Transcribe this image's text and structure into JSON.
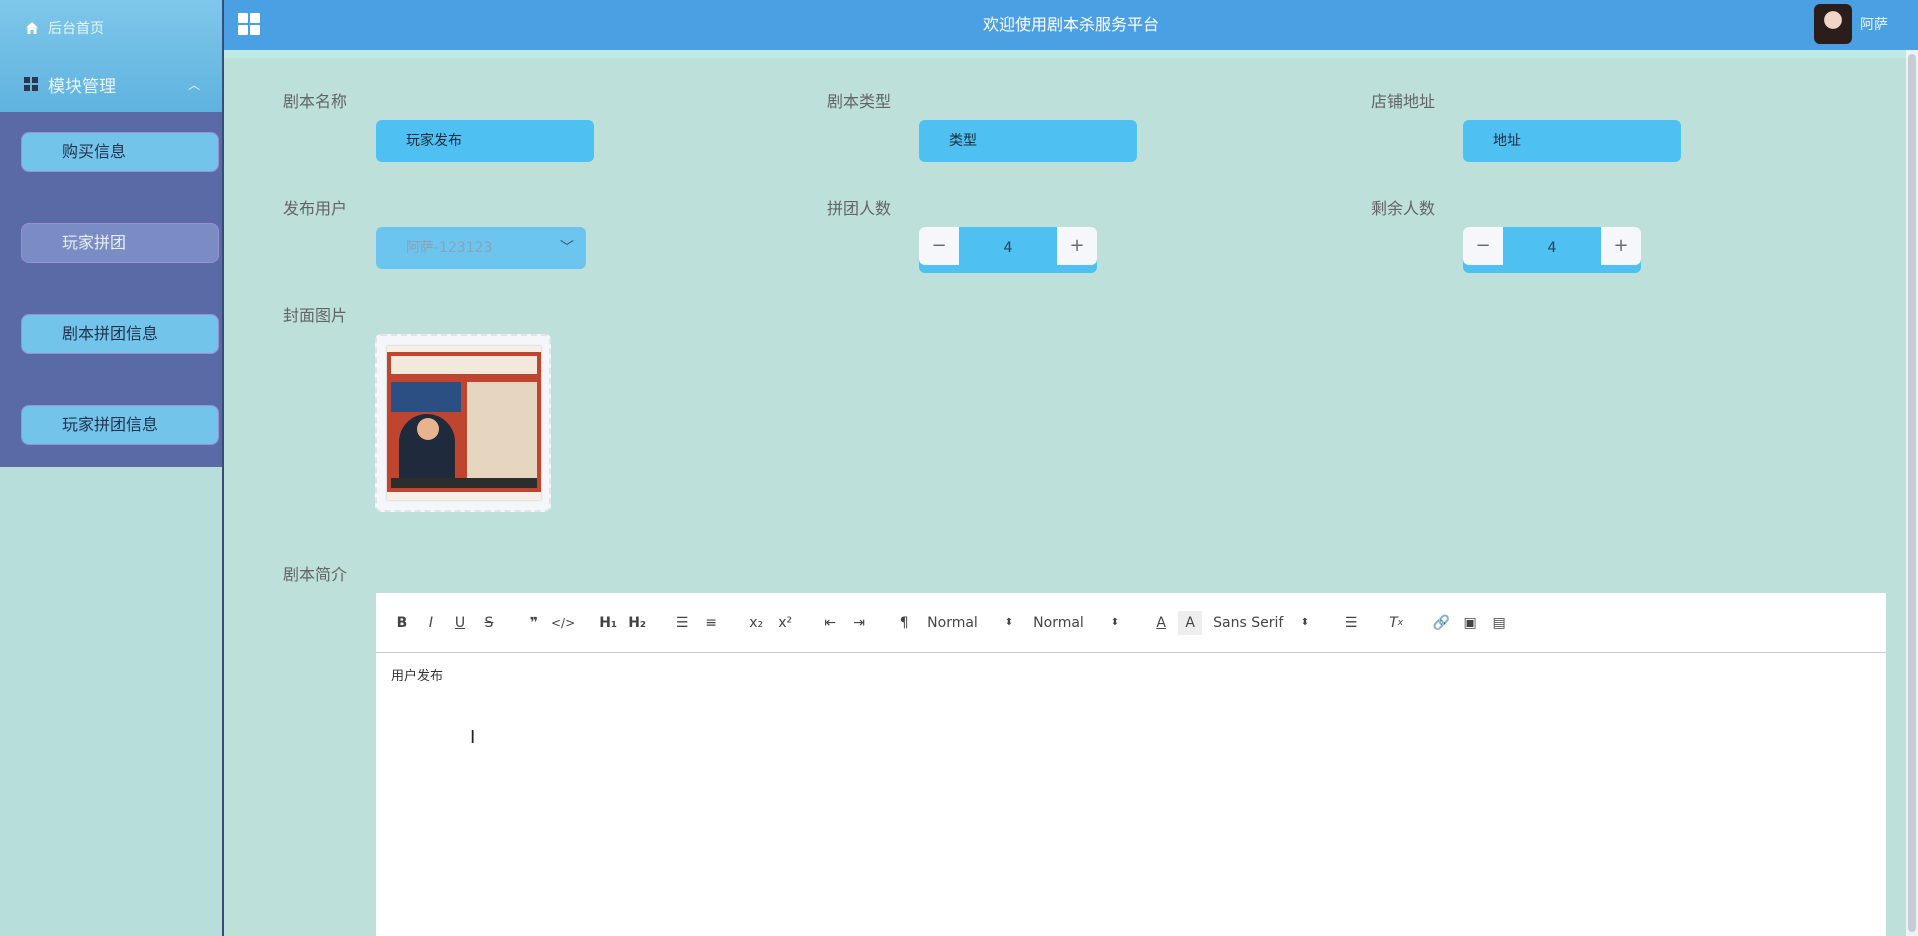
{
  "sidebar": {
    "home": "后台首页",
    "module": "模块管理",
    "items": [
      {
        "label": "购买信息",
        "active": false
      },
      {
        "label": "玩家拼团",
        "active": true
      },
      {
        "label": "剧本拼团信息",
        "active": false
      },
      {
        "label": "玩家拼团信息",
        "active": false
      }
    ]
  },
  "header": {
    "title": "欢迎使用剧本杀服务平台",
    "username": "阿萨"
  },
  "form": {
    "name_label": "剧本名称",
    "name_value": "玩家发布",
    "type_label": "剧本类型",
    "type_value": "类型",
    "address_label": "店铺地址",
    "address_value": "地址",
    "user_label": "发布用户",
    "user_value": "阿萨-123123",
    "group_count_label": "拼团人数",
    "group_count_value": "4",
    "remaining_label": "剩余人数",
    "remaining_value": "4",
    "cover_label": "封面图片",
    "intro_label": "剧本简介"
  },
  "editor": {
    "header_picker": "Normal",
    "size_picker": "Normal",
    "font_picker": "Sans Serif",
    "content": "用户发布"
  },
  "colors": {
    "header_bg": "#4ba0e4",
    "input_bg": "#4fc0f2",
    "sidebar_menu_bg": "#5a6aa6",
    "main_bg": "#bde0da"
  }
}
